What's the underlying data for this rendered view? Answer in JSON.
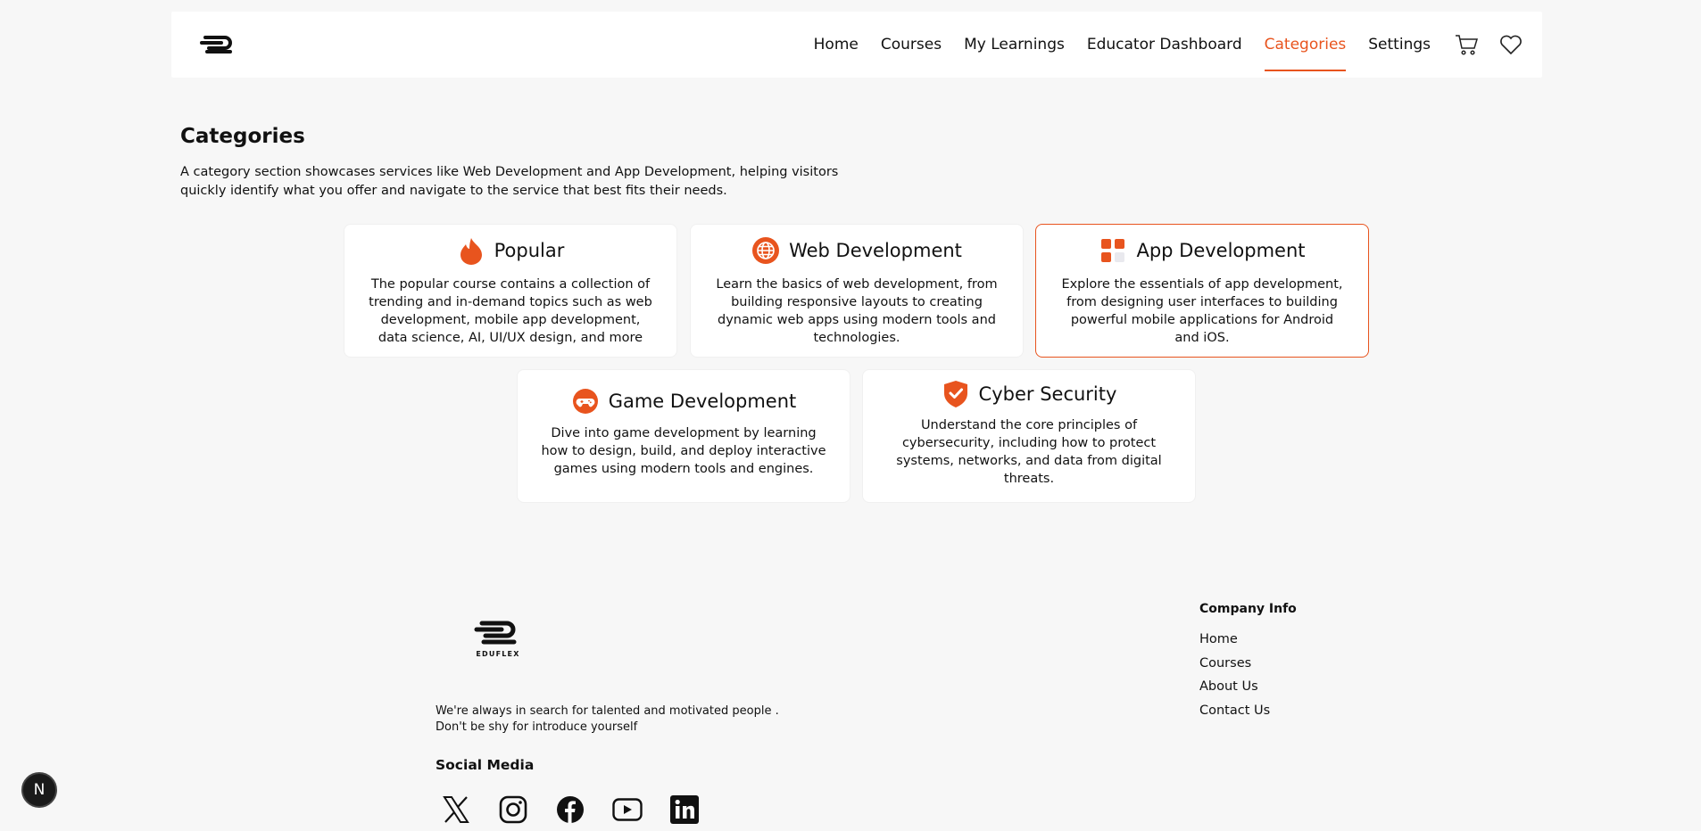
{
  "nav": {
    "items": [
      {
        "label": "Home"
      },
      {
        "label": "Courses"
      },
      {
        "label": "My Learnings"
      },
      {
        "label": "Educator Dashboard"
      },
      {
        "label": "Categories",
        "active": true
      },
      {
        "label": "Settings"
      }
    ],
    "icons": [
      "cart-icon",
      "heart-icon"
    ]
  },
  "page": {
    "title": "Categories",
    "description": "A category section showcases services like Web Development and App Development, helping visitors quickly identify what you offer and navigate to the service that best fits their needs."
  },
  "cards": [
    {
      "title": "Popular",
      "icon": "flame-icon",
      "desc": "The popular course contains a collection of trending and in-demand topics such as web development, mobile app development, data science, AI, UI/UX design, and more"
    },
    {
      "title": "Web Development",
      "icon": "globe-icon",
      "desc": "Learn the basics of web development, from building responsive layouts to creating dynamic web apps using modern tools and technologies."
    },
    {
      "title": "App Development",
      "icon": "apps-grid-icon",
      "desc": "Explore the essentials of app development, from designing user interfaces to building powerful mobile applications for Android and iOS."
    },
    {
      "title": "Game Development",
      "icon": "gamepad-icon",
      "desc": "Dive into game development by learning how to design, build, and deploy interactive games using modern tools and engines."
    },
    {
      "title": "Cyber Security",
      "icon": "shield-check-icon",
      "desc": "Understand the core principles of cybersecurity, including how to protect systems, networks, and data from digital threats."
    }
  ],
  "footer": {
    "logo_text": "EDUFLEX",
    "blurb_line1": "We're always in search for talented and motivated people .",
    "blurb_line2": "Don't be shy for introduce yourself",
    "social_title": "Social Media",
    "social_icons": [
      "x-icon",
      "instagram-icon",
      "facebook-icon",
      "youtube-icon",
      "linkedin-icon"
    ],
    "company_title": "Company Info",
    "company_links": [
      "Home",
      "Courses",
      "About Us",
      "Contact Us"
    ]
  },
  "badge": "N",
  "colors": {
    "accent": "#e8541e",
    "background": "#f7f7f7"
  }
}
